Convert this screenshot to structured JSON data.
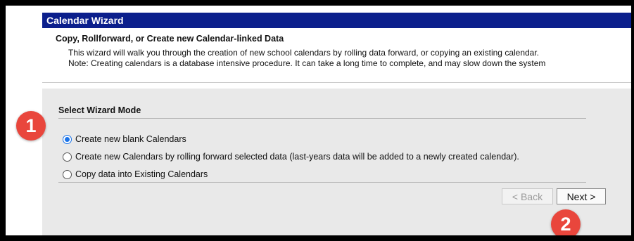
{
  "window": {
    "title": "Calendar Wizard"
  },
  "header": {
    "heading": "Copy, Rollforward, or Create new Calendar-linked Data",
    "description_line1": "This wizard will walk you through the creation of new school calendars by rolling data forward, or copying an existing calendar.",
    "description_line2": "Note: Creating calendars is a database intensive procedure. It can take a long time to complete, and may slow down the system"
  },
  "mode_section": {
    "title": "Select Wizard Mode",
    "options": [
      {
        "label": "Create new blank Calendars",
        "selected": true
      },
      {
        "label": "Create new Calendars by rolling forward selected data (last-years data will be added to a newly created calendar).",
        "selected": false
      },
      {
        "label": "Copy data into Existing Calendars",
        "selected": false
      }
    ]
  },
  "buttons": {
    "back": "< Back",
    "next": "Next >"
  },
  "callouts": {
    "step1": "1",
    "step2": "2"
  },
  "colors": {
    "titlebar": "#0b1f8c",
    "callout": "#e9463c",
    "radio_selected": "#1a73e8"
  }
}
